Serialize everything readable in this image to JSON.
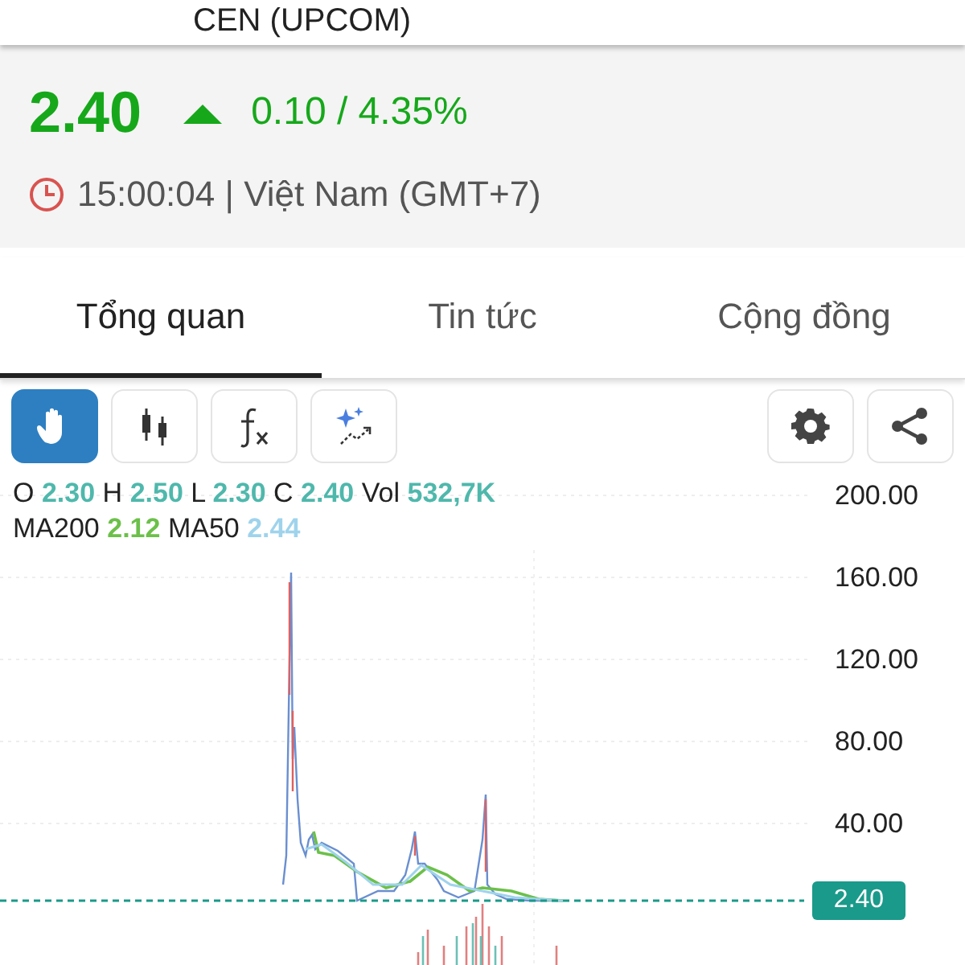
{
  "header": {
    "title": "CEN (UPCOM)"
  },
  "quote": {
    "price": "2.40",
    "rising": true,
    "change": "0.10 / 4.35%",
    "time": "15:00:04 | Việt Nam (GMT+7)"
  },
  "tabs": [
    {
      "label": "Tổng quan",
      "selected": true
    },
    {
      "label": "Tin tức",
      "selected": false
    },
    {
      "label": "Cộng đồng",
      "selected": false
    }
  ],
  "toolbar": {
    "left": [
      {
        "kind": "hand",
        "selected": true
      },
      {
        "kind": "candles",
        "selected": false
      },
      {
        "kind": "formula",
        "selected": false
      },
      {
        "kind": "sparkle",
        "selected": false
      }
    ],
    "right": [
      {
        "kind": "settings"
      },
      {
        "kind": "share"
      }
    ]
  },
  "legend": [
    [
      {
        "label": "O",
        "value": "2.30",
        "color": "#4fb8ac"
      },
      {
        "label": "H",
        "value": "2.50",
        "color": "#4fb8ac"
      },
      {
        "label": "L",
        "value": "2.30",
        "color": "#4fb8ac"
      },
      {
        "label": "C",
        "value": "2.40",
        "color": "#4fb8ac"
      },
      {
        "label": "Vol",
        "value": "532,7K",
        "color": "#4fb8ac"
      }
    ],
    [
      {
        "label": "MA200",
        "value": "2.12",
        "color": "#6cc04a"
      },
      {
        "label": "MA50",
        "value": "2.44",
        "color": "#9fd3ec"
      }
    ]
  ],
  "axis_labels": [
    "200.00",
    "160.00",
    "120.00",
    "80.00",
    "40.00"
  ],
  "last_price": "2.40"
}
